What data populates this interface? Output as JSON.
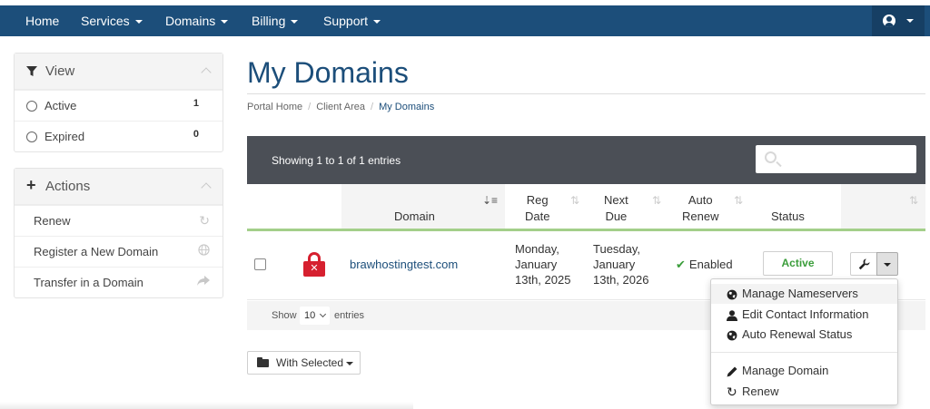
{
  "nav": {
    "items": [
      {
        "label": "Home"
      },
      {
        "label": "Services"
      },
      {
        "label": "Domains"
      },
      {
        "label": "Billing"
      },
      {
        "label": "Support"
      }
    ],
    "bar_color": "#1c4e7a"
  },
  "sidebar": {
    "view": {
      "title": "View",
      "items": [
        {
          "label": "Active",
          "count": "1"
        },
        {
          "label": "Expired",
          "count": "0"
        }
      ]
    },
    "actions": {
      "title": "Actions",
      "items": [
        {
          "label": "Renew",
          "icon": "refresh-icon"
        },
        {
          "label": "Register a New Domain",
          "icon": "globe-icon"
        },
        {
          "label": "Transfer in a Domain",
          "icon": "share-arrow-icon"
        }
      ]
    }
  },
  "page": {
    "title": "My Domains",
    "breadcrumb": [
      "Portal Home",
      "Client Area",
      "My Domains"
    ]
  },
  "table": {
    "showing": "Showing 1 to 1 of 1 entries",
    "search_placeholder": "",
    "columns": {
      "domain": "Domain",
      "reg_date": [
        "Reg",
        "Date"
      ],
      "next_due": [
        "Next",
        "Due"
      ],
      "auto_renew": [
        "Auto",
        "Renew"
      ],
      "status": "Status"
    },
    "rows": [
      {
        "domain": "brawhostingtest.com",
        "reg_date": [
          "Monday,",
          "January",
          "13th, 2025"
        ],
        "next_due": [
          "Tuesday,",
          "January",
          "13th, 2026"
        ],
        "auto_renew": "Enabled",
        "status": "Active"
      }
    ],
    "footer": {
      "show": "Show",
      "page_size": "10",
      "entries": "entries"
    },
    "with_selected": "With Selected",
    "accent_green": "#a3cf8a",
    "status_green": "#3a9d3a"
  },
  "dropdown": {
    "items": [
      {
        "label": "Manage Nameservers",
        "icon": "globe-icon"
      },
      {
        "label": "Edit Contact Information",
        "icon": "user-icon"
      },
      {
        "label": "Auto Renewal Status",
        "icon": "globe-icon"
      },
      {
        "label": "Manage Domain",
        "icon": "pencil-icon"
      },
      {
        "label": "Renew",
        "icon": "refresh-icon"
      }
    ]
  }
}
